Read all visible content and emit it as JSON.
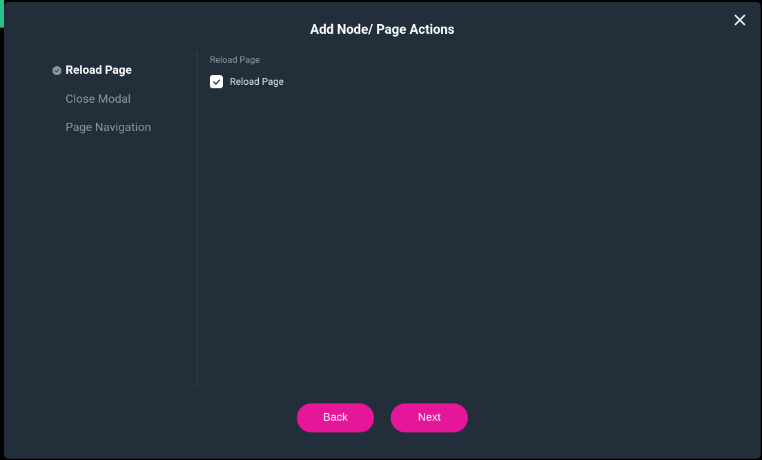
{
  "modal": {
    "title": "Add Node/ Page Actions"
  },
  "sidebar": {
    "items": [
      {
        "label": "Reload Page",
        "active": true
      },
      {
        "label": "Close Modal",
        "active": false
      },
      {
        "label": "Page Navigation",
        "active": false
      }
    ]
  },
  "content": {
    "section_label": "Reload Page",
    "checkbox_label": "Reload Page",
    "checkbox_checked": true
  },
  "footer": {
    "back_label": "Back",
    "next_label": "Next"
  },
  "colors": {
    "accent": "#e6169a",
    "bg": "#222f3b"
  }
}
